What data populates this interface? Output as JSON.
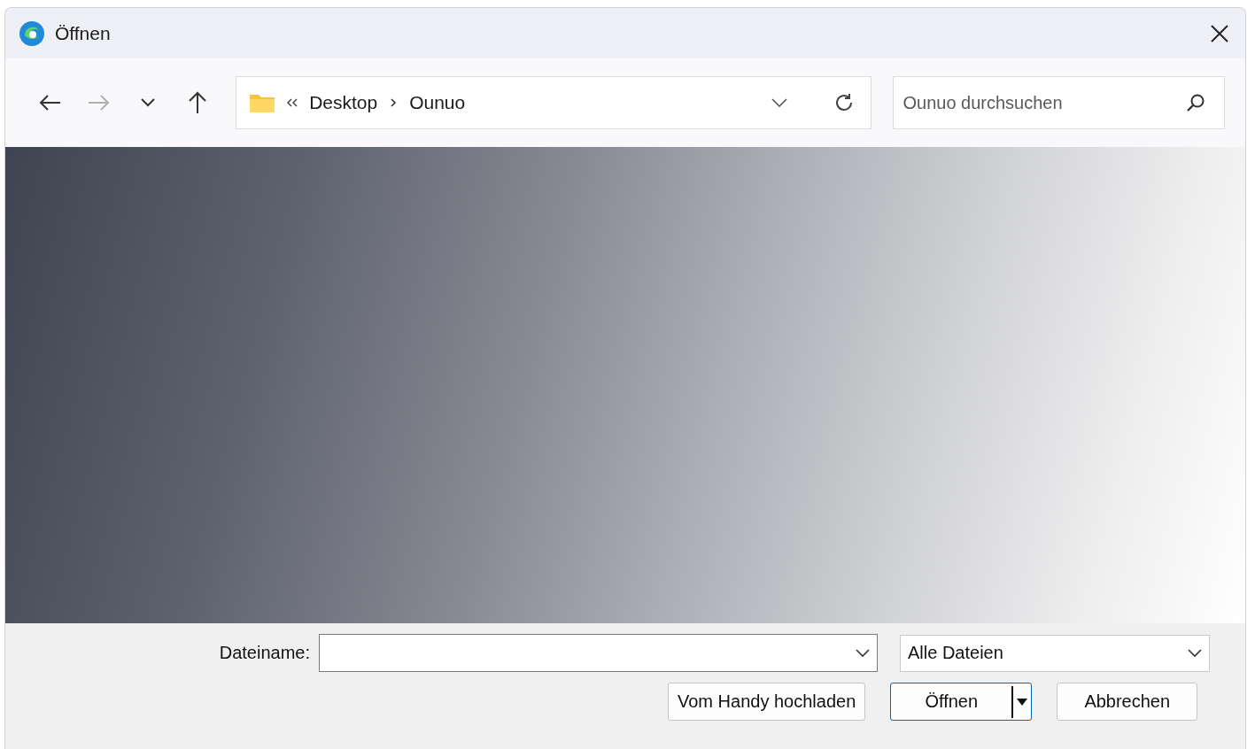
{
  "window": {
    "title": "Öffnen"
  },
  "navigation": {
    "back_disabled": false,
    "forward_disabled": true,
    "path": [
      {
        "label": "Desktop"
      },
      {
        "label": "Ounuo"
      }
    ]
  },
  "search": {
    "placeholder": "Ounuo durchsuchen"
  },
  "file_name": {
    "label": "Dateiname:"
  },
  "file_type": {
    "value": "Alle Dateien"
  },
  "buttons": [
    {
      "label": "Vom Handy hochladen",
      "kind": "plain"
    },
    {
      "label": "Öffnen",
      "kind": "split"
    },
    {
      "label": "Abbrechen",
      "kind": "plain"
    }
  ]
}
